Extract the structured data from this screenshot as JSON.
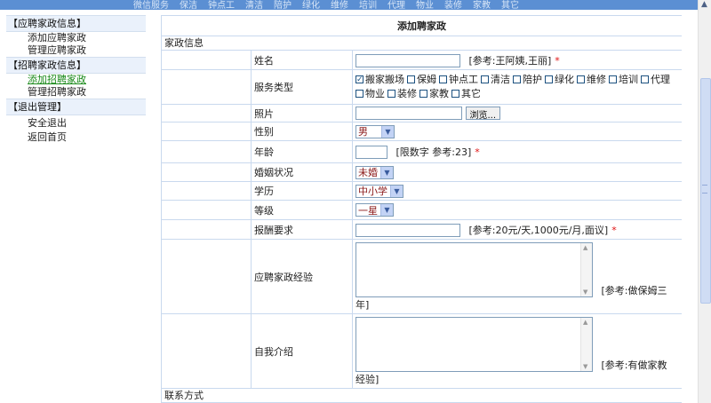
{
  "topnav": [
    "微信服务",
    "保洁",
    "钟点工",
    "清洁",
    "陪护",
    "绿化",
    "维修",
    "培训",
    "代理",
    "物业",
    "装修",
    "家教",
    "其它"
  ],
  "sidebar": {
    "groups": [
      {
        "header": "【应聘家政信息】",
        "items": [
          "添加应聘家政",
          "管理应聘家政"
        ]
      },
      {
        "header": "【招聘家政信息】",
        "items": [
          "添加招聘家政",
          "管理招聘家政"
        ]
      },
      {
        "header": "【退出管理】",
        "items": [
          "安全退出",
          "返回首页"
        ]
      }
    ]
  },
  "form": {
    "title": "添加聘家政",
    "section_label": "家政信息",
    "name": {
      "label": "姓名",
      "value": "",
      "hint": "[参考:王阿姨,王丽]",
      "required": "*"
    },
    "service_type": {
      "label": "服务类型",
      "options": [
        {
          "label": "搬家搬场",
          "checked": true
        },
        {
          "label": "保姆",
          "checked": false
        },
        {
          "label": "钟点工",
          "checked": false
        },
        {
          "label": "清洁",
          "checked": false
        },
        {
          "label": "陪护",
          "checked": false
        },
        {
          "label": "绿化",
          "checked": false
        },
        {
          "label": "维修",
          "checked": false
        },
        {
          "label": "培训",
          "checked": false
        },
        {
          "label": "代理",
          "checked": false
        },
        {
          "label": "物业",
          "checked": false
        },
        {
          "label": "装修",
          "checked": false
        },
        {
          "label": "家教",
          "checked": false
        },
        {
          "label": "其它",
          "checked": false
        }
      ]
    },
    "photo": {
      "label": "照片",
      "button": "浏览..."
    },
    "gender": {
      "label": "性别",
      "value": "男"
    },
    "age": {
      "label": "年龄",
      "value": "",
      "hint": "[限数字 参考:23]",
      "required": "*"
    },
    "marital": {
      "label": "婚姻状况",
      "value": "未婚"
    },
    "education": {
      "label": "学历",
      "value": "中小学"
    },
    "level": {
      "label": "等级",
      "value": "一星"
    },
    "salary": {
      "label": "报酬要求",
      "value": "",
      "hint": "[参考:20元/天,1000元/月,面议]",
      "required": "*"
    },
    "experience": {
      "label": "应聘家政经验",
      "hint_line1": "[参考:做保姆三",
      "hint_line2": "年]"
    },
    "intro": {
      "label": "自我介绍",
      "hint_line1": "[参考:有做家教",
      "hint_line2": "经验]"
    },
    "next_section": "联系方式"
  }
}
